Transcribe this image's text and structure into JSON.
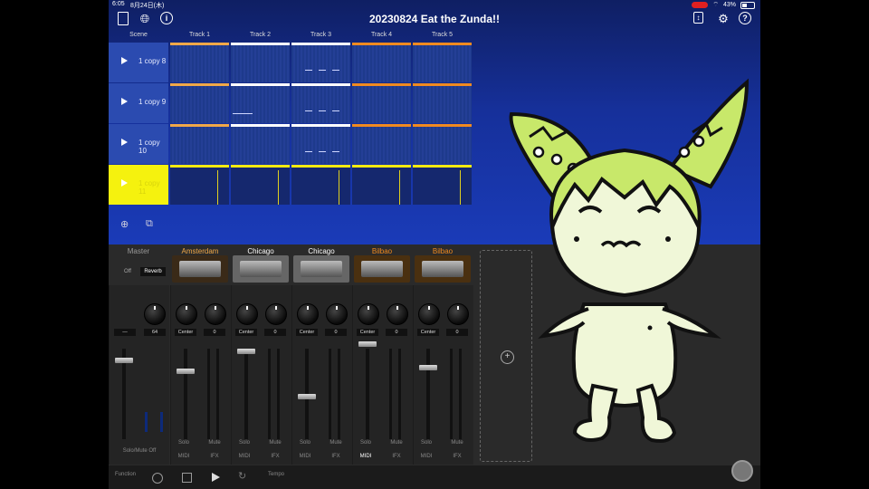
{
  "status": {
    "time": "6:05",
    "date": "8月24日(木)",
    "battery": "43%"
  },
  "project_title": "20230824 Eat the Zunda!!",
  "scene_header": "Scene",
  "tracks": [
    "Track 1",
    "Track 2",
    "Track 3",
    "Track 4",
    "Track 5"
  ],
  "track_colors": [
    "#f0a848",
    "#ffffff",
    "#ffffff",
    "#f08a20",
    "#f08a20"
  ],
  "scenes": [
    {
      "label": "1 copy 8"
    },
    {
      "label": "1 copy 9"
    },
    {
      "label": "1 copy 10"
    },
    {
      "label": "1 copy 11",
      "selected": true
    }
  ],
  "mixer": {
    "master": {
      "name": "Master",
      "off": "Off",
      "reverb": "Reverb",
      "value": "64",
      "pan": "—",
      "solo_mute": "Solo/Mute Off"
    },
    "channels": [
      {
        "name": "Amsterdam",
        "pan": "Center",
        "send": "0",
        "solo": "Solo",
        "mute": "Mute",
        "midi": "MIDI",
        "ifx": "IFX",
        "color": "#f0a848"
      },
      {
        "name": "Chicago",
        "pan": "Center",
        "send": "0",
        "solo": "Solo",
        "mute": "Mute",
        "midi": "MIDI",
        "ifx": "IFX",
        "color": "#ffffff"
      },
      {
        "name": "Chicago",
        "pan": "Center",
        "send": "0",
        "solo": "Solo",
        "mute": "Mute",
        "midi": "MIDI",
        "ifx": "IFX",
        "color": "#ffffff"
      },
      {
        "name": "Bilbao",
        "pan": "Center",
        "send": "0",
        "solo": "Solo",
        "mute": "Mute",
        "midi": "MIDI",
        "ifx": "IFX",
        "color": "#f08a20"
      },
      {
        "name": "Bilbao",
        "pan": "Center",
        "send": "0",
        "solo": "Solo",
        "mute": "Mute",
        "midi": "MIDI",
        "ifx": "IFX",
        "color": "#f08a20"
      }
    ]
  },
  "transport": {
    "function": "Function",
    "tempo": "Tempo"
  }
}
